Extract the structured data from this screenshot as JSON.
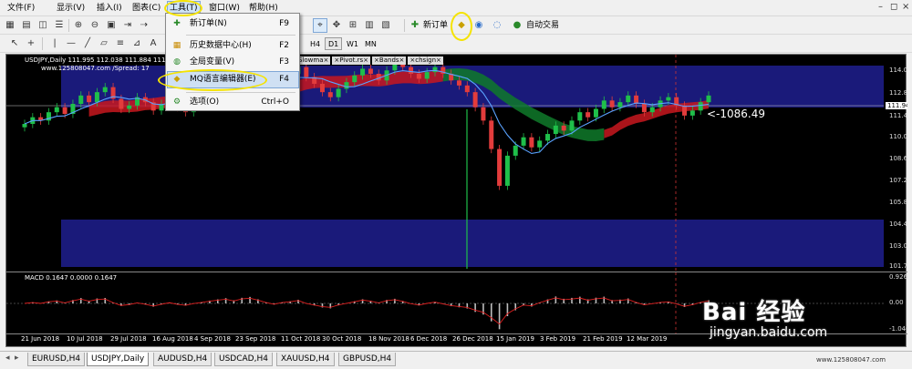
{
  "menu": [
    "文件(F)",
    "显示(V)",
    "插入(I)",
    "图表(C)",
    "工具(T)",
    "窗口(W)",
    "帮助(H)"
  ],
  "toolbar": {
    "new_order": "新订单",
    "auto_trade": "自动交易"
  },
  "timeframes": [
    "H4",
    "D1",
    "W1",
    "MN"
  ],
  "dropdown": [
    {
      "label": "新订单(N)",
      "key": "F9",
      "icon": "new-order-icon"
    },
    {
      "label": "历史数据中心(H)",
      "key": "F2",
      "icon": "history-center-icon"
    },
    {
      "label": "全局变量(V)",
      "key": "F3",
      "icon": "global-variables-icon"
    },
    {
      "label": "MQ语言编辑器(E)",
      "key": "F4",
      "icon": "metaeditor-icon"
    },
    {
      "label": "选项(O)",
      "key": "Ctrl+O",
      "icon": "options-icon"
    }
  ],
  "chart": {
    "ohlc": "USDJPY,Daily   111.995 112.038 111.884 111.942",
    "site": "www.125808047.com /Spread:   17",
    "indicators": [
      "Slowma×",
      "×Pivot.rs×",
      "×Bands×",
      "×chsign×"
    ],
    "price_label": "<-1086.49",
    "current_price": "111.942",
    "price_ticks": [
      "114.070",
      "112.820",
      "111.460",
      "110.060",
      "108.660",
      "107.260",
      "105.860",
      "104.460",
      "103.060",
      "101.700"
    ],
    "macd_label": "MACD 0.1647 0.0000 0.1647",
    "macd_ticks": [
      "0.9267",
      "0.00",
      "-1.0461"
    ],
    "x_ticks": [
      "21 Jun 2018",
      "10 Jul 2018",
      "29 Jul 2018",
      "16 Aug 2018",
      "4 Sep 2018",
      "23 Sep 2018",
      "11 Oct 2018",
      "30 Oct 2018",
      "18 Nov 2018",
      "6 Dec 2018",
      "26 Dec 2018",
      "15 Jan 2019",
      "3 Feb 2019",
      "21 Feb 2019",
      "12 Mar 2019"
    ]
  },
  "tabs": [
    "EURUSD,H4",
    "USDJPY,Daily",
    "AUDUSD,H4",
    "USDCAD,H4",
    "XAUUSD,H4",
    "GBPUSD,H4"
  ],
  "watermark": {
    "brand": "Bai 经验",
    "url": "jingyan.baidu.com",
    "footer": "www.125808047.com"
  },
  "chart_data": {
    "type": "candlestick",
    "symbol": "USDJPY",
    "timeframe": "Daily",
    "ylim": [
      101.7,
      114.07
    ],
    "closes": [
      110.2,
      110.6,
      110.4,
      110.9,
      111.2,
      110.8,
      111.4,
      111.9,
      111.5,
      112.1,
      112.4,
      111.7,
      111.1,
      111.3,
      111.8,
      111.5,
      111.0,
      111.4,
      111.7,
      111.2,
      110.9,
      111.3,
      111.6,
      111.9,
      112.2,
      112.6,
      112.3,
      112.9,
      113.3,
      113.1,
      112.7,
      112.4,
      112.9,
      113.2,
      113.6,
      113.0,
      112.6,
      112.1,
      111.8,
      112.3,
      112.7,
      113.1,
      113.5,
      113.2,
      112.8,
      113.4,
      113.8,
      113.6,
      113.2,
      112.9,
      113.3,
      113.6,
      113.2,
      112.8,
      112.5,
      112.1,
      111.2,
      110.4,
      108.7,
      106.5,
      108.3,
      108.9,
      109.4,
      108.8,
      109.2,
      109.6,
      110.1,
      109.8,
      110.4,
      110.9,
      110.6,
      111.1,
      111.6,
      111.2,
      111.5,
      111.9,
      111.4,
      110.9,
      111.2,
      111.6,
      111.8,
      111.3,
      110.7,
      111.0,
      111.5,
      111.9
    ]
  }
}
